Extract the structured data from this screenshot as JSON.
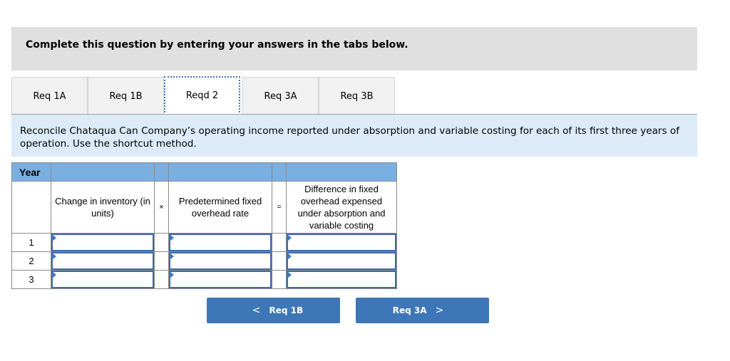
{
  "instructions": "Complete this question by entering your answers in the tabs below.",
  "tabs": [
    {
      "label": "Req 1A",
      "active": false
    },
    {
      "label": "Req 1B",
      "active": false
    },
    {
      "label": "Reqd 2",
      "active": true
    },
    {
      "label": "Req 3A",
      "active": false
    },
    {
      "label": "Req 3B",
      "active": false
    }
  ],
  "description": "Reconcile Chataqua Can Company’s operating income reported under absorption and variable costing for each of its first three years of operation. Use the shortcut method.",
  "table": {
    "year_header": "Year",
    "columns": {
      "change_in_inventory": "Change in inventory (in units)",
      "times_operator": "×",
      "fixed_overhead_rate": "Predetermined fixed overhead rate",
      "equals_operator": "=",
      "difference": "Difference in fixed overhead expensed under absorption and variable costing"
    },
    "rows": [
      {
        "year": "1",
        "change_in_inventory": "",
        "fixed_overhead_rate": "",
        "difference": ""
      },
      {
        "year": "2",
        "change_in_inventory": "",
        "fixed_overhead_rate": "",
        "difference": ""
      },
      {
        "year": "3",
        "change_in_inventory": "",
        "fixed_overhead_rate": "",
        "difference": ""
      }
    ]
  },
  "navigation": {
    "prev_label": "Req 1B",
    "prev_icon": "chevron-left-icon",
    "prev_glyph": "<",
    "next_label": "Req 3A",
    "next_icon": "chevron-right-icon",
    "next_glyph": ">"
  },
  "colors": {
    "accent": "#3e77b7",
    "table_header": "#7aafe1",
    "description_bg": "#dcebf7",
    "instructions_bg": "#e0e0e0"
  }
}
